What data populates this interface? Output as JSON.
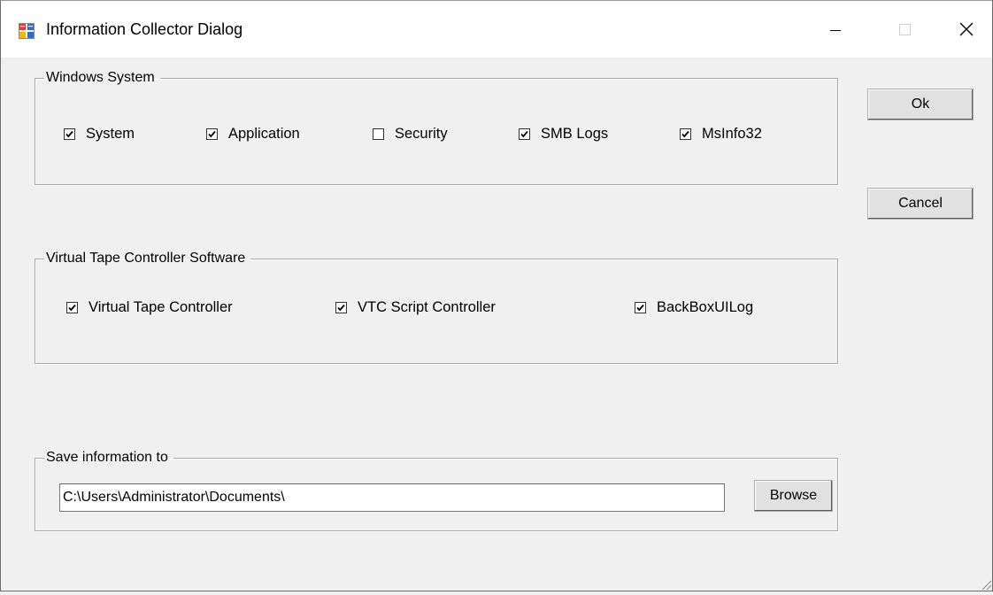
{
  "window": {
    "title": "Information Collector Dialog",
    "icon": "app-form-icon"
  },
  "title_controls": [
    "minimize-icon",
    "maximize-icon",
    "close-icon"
  ],
  "groups": {
    "windows_system": {
      "label": "Windows System",
      "checkboxes": [
        {
          "label": "System",
          "checked": true
        },
        {
          "label": "Application",
          "checked": true
        },
        {
          "label": "Security",
          "checked": false
        },
        {
          "label": "SMB Logs",
          "checked": true
        },
        {
          "label": "MsInfo32",
          "checked": true
        }
      ]
    },
    "vtc_software": {
      "label": "Virtual Tape Controller Software",
      "checkboxes": [
        {
          "label": "Virtual Tape Controller",
          "checked": true
        },
        {
          "label": "VTC Script Controller",
          "checked": true
        },
        {
          "label": "BackBoxUILog",
          "checked": true
        }
      ]
    },
    "save": {
      "label": "Save information to",
      "path_value": "C:\\Users\\Administrator\\Documents\\",
      "browse_label": "Browse"
    }
  },
  "buttons": {
    "ok_label": "Ok",
    "cancel_label": "Cancel"
  },
  "colors": {
    "window_bg": "#f0f0f0",
    "titlebar_bg": "#ffffff",
    "button_bg": "#e1e1e1"
  }
}
